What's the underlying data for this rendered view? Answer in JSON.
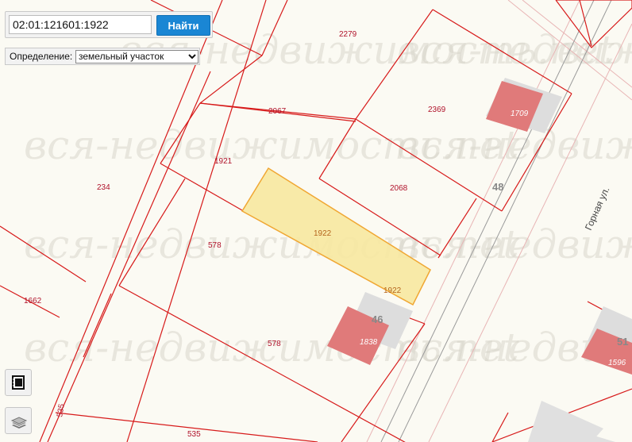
{
  "search": {
    "value": "02:01:121601:1922",
    "button_label": "Найти"
  },
  "definition": {
    "label": "Определение:",
    "selected": "земельный участок"
  },
  "watermark": "вся-недвижимость.net",
  "street": "Горная ул.",
  "parcel_labels": {
    "p2279": "2279",
    "p2067": "2067",
    "p2369": "2369",
    "p1921": "1921",
    "p2068": "2068",
    "p234": "234",
    "p578a": "578",
    "p1922": "1922",
    "p1922b": "1922",
    "p1662": "1662",
    "p578b": "578",
    "p535a": "535",
    "p535b": "535"
  },
  "building_labels": {
    "b1709": "1709",
    "b1838": "1838",
    "b1596": "1596"
  },
  "house_numbers": {
    "h48": "48",
    "h46": "46",
    "h51": "51"
  },
  "colors": {
    "boundary": "#d71a1a",
    "selected_fill": "#f7e8a0",
    "selected_stroke": "#f0a733",
    "building_fill": "#e07a7a",
    "building_shadow": "#dddddd",
    "button": "#1a86d4"
  },
  "icons": {
    "ruler": "ruler-icon",
    "layers": "layers-icon",
    "dropdown": "chevron-down-icon"
  }
}
